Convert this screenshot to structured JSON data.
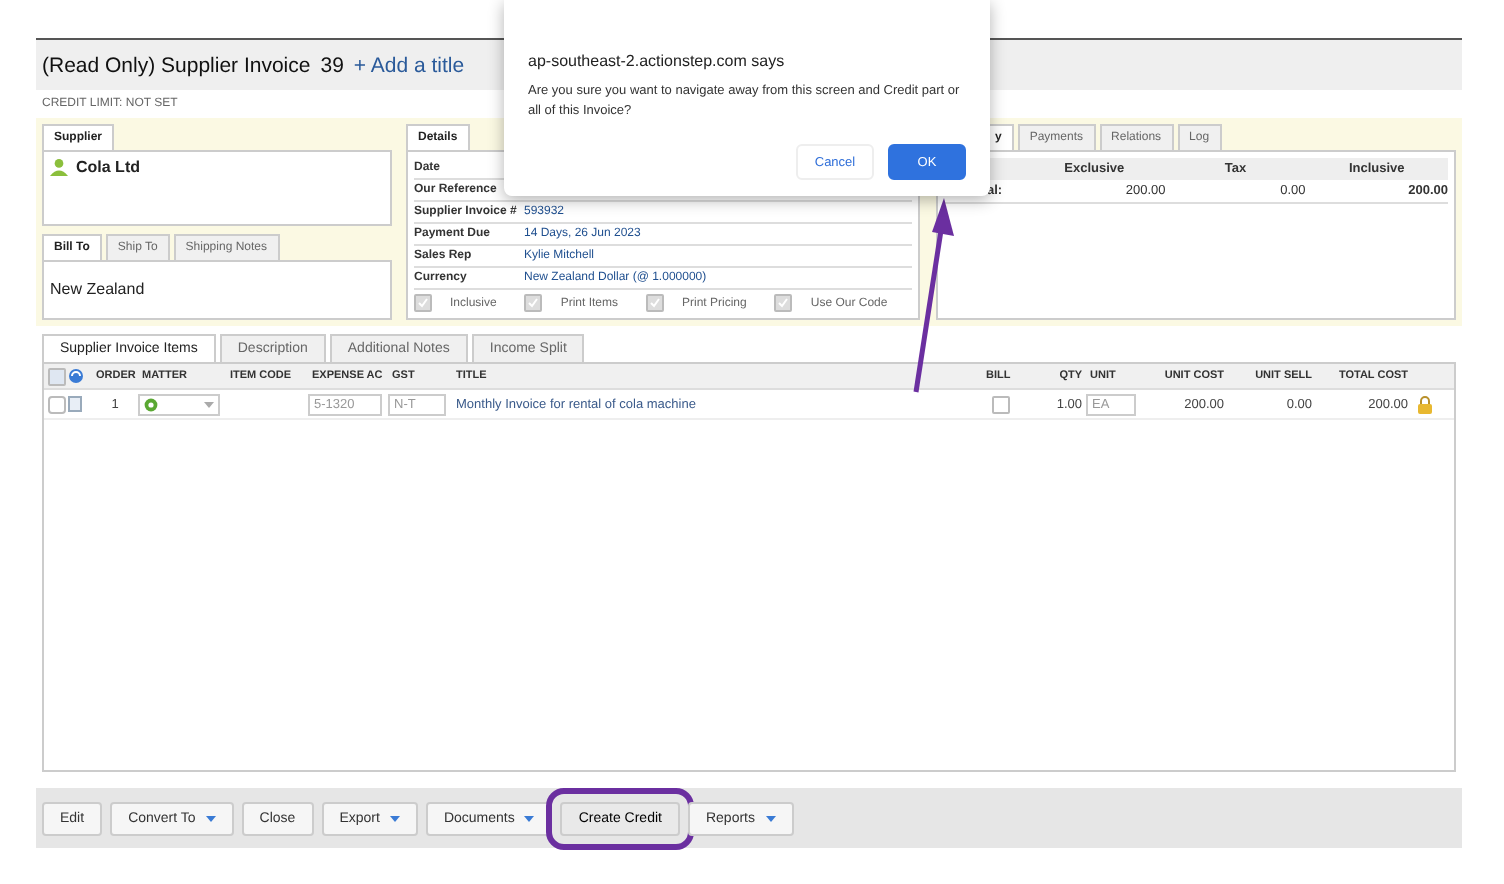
{
  "header": {
    "title": "(Read Only) Supplier Invoice",
    "number": "39",
    "add_title": "+ Add a title",
    "credit_limit": "CREDIT LIMIT: NOT SET"
  },
  "supplier": {
    "tab": "Supplier",
    "name": "Cola Ltd"
  },
  "address": {
    "tabs": [
      {
        "label": "Bill To",
        "selected": true
      },
      {
        "label": "Ship To",
        "selected": false
      },
      {
        "label": "Shipping Notes",
        "selected": false
      }
    ],
    "text": "New Zealand"
  },
  "details": {
    "tab": "Details",
    "rows": [
      {
        "label": "Date"
      },
      {
        "label": "Our Reference"
      },
      {
        "label": "Supplier Invoice #",
        "value": "593932"
      },
      {
        "label": "Payment Due",
        "value": "14 Days, 26 Jun 2023"
      },
      {
        "label": "Sales Rep",
        "value": "Kylie Mitchell"
      },
      {
        "label": "Currency",
        "value": "New Zealand Dollar (@ 1.000000)"
      }
    ],
    "options": [
      {
        "label": "Inclusive",
        "checked": true
      },
      {
        "label": "Print Items",
        "checked": true
      },
      {
        "label": "Print Pricing",
        "checked": true
      },
      {
        "label": "Use Our Code",
        "checked": true
      }
    ]
  },
  "summary": {
    "tabs": [
      {
        "label": "y",
        "selected": true
      },
      {
        "label": "Payments",
        "selected": false
      },
      {
        "label": "Relations",
        "selected": false
      },
      {
        "label": "Log",
        "selected": false
      }
    ],
    "columns": [
      "Exclusive",
      "Tax",
      "Inclusive"
    ],
    "rows": [
      {
        "label": "al:",
        "exclusive": "200.00",
        "tax": "0.00",
        "inclusive": "200.00"
      }
    ]
  },
  "items": {
    "tabs": [
      {
        "label": "Supplier Invoice Items",
        "selected": true
      },
      {
        "label": "Description",
        "selected": false
      },
      {
        "label": "Additional Notes",
        "selected": false
      },
      {
        "label": "Income Split",
        "selected": false
      }
    ],
    "select_all": {
      "checked": false
    },
    "columns": [
      "ORDER",
      "MATTER",
      "ITEM CODE",
      "EXPENSE AC",
      "GST",
      "TITLE",
      "BILL",
      "QTY",
      "UNIT",
      "UNIT COST",
      "UNIT SELL",
      "TOTAL COST"
    ],
    "rows": [
      {
        "checked": false,
        "order": "1",
        "expense_account": "5-1320",
        "gst": "N-T",
        "title": "Monthly Invoice for rental of cola machine",
        "bill": false,
        "qty": "1.00",
        "unit": "EA",
        "unit_cost": "200.00",
        "unit_sell": "0.00",
        "total_cost": "200.00",
        "locked": true
      }
    ]
  },
  "toolbar": [
    {
      "label": "Edit",
      "dropdown": false,
      "highlighted": false
    },
    {
      "label": "Convert To",
      "dropdown": true,
      "highlighted": false
    },
    {
      "label": "Close",
      "dropdown": false,
      "highlighted": false
    },
    {
      "label": "Export",
      "dropdown": true,
      "highlighted": false
    },
    {
      "label": "Documents",
      "dropdown": true,
      "highlighted": false
    },
    {
      "label": "Create Credit",
      "dropdown": false,
      "highlighted": true
    },
    {
      "label": "Reports",
      "dropdown": true,
      "highlighted": false
    }
  ],
  "dialog": {
    "title": "ap-southeast-2.actionstep.com says",
    "message": "Are you sure you want to navigate away from this screen and Credit part or all of this Invoice?",
    "buttons": [
      {
        "label": "Cancel",
        "primary": false
      },
      {
        "label": "OK",
        "primary": true
      }
    ]
  }
}
